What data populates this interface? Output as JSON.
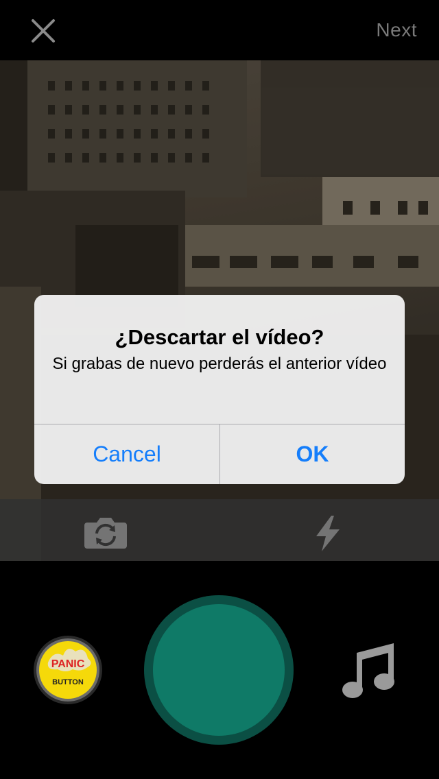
{
  "header": {
    "close_icon": "close-icon",
    "next_label": "Next"
  },
  "alert": {
    "title": "¿Descartar el vídeo?",
    "message": "Si grabas de nuevo perderás el anterior vídeo",
    "cancel_label": "Cancel",
    "ok_label": "OK",
    "button_color": "#157efb"
  },
  "camera_tools": {
    "flip_icon": "flip-camera-icon",
    "flash_icon": "flash-icon"
  },
  "recorder": {
    "record_color": "#0f7a67",
    "sticker_icon": "panic-button-icon",
    "sticker_text_top": "PANIC",
    "sticker_text_bottom": "BUTTON",
    "music_icon": "music-note-icon"
  }
}
